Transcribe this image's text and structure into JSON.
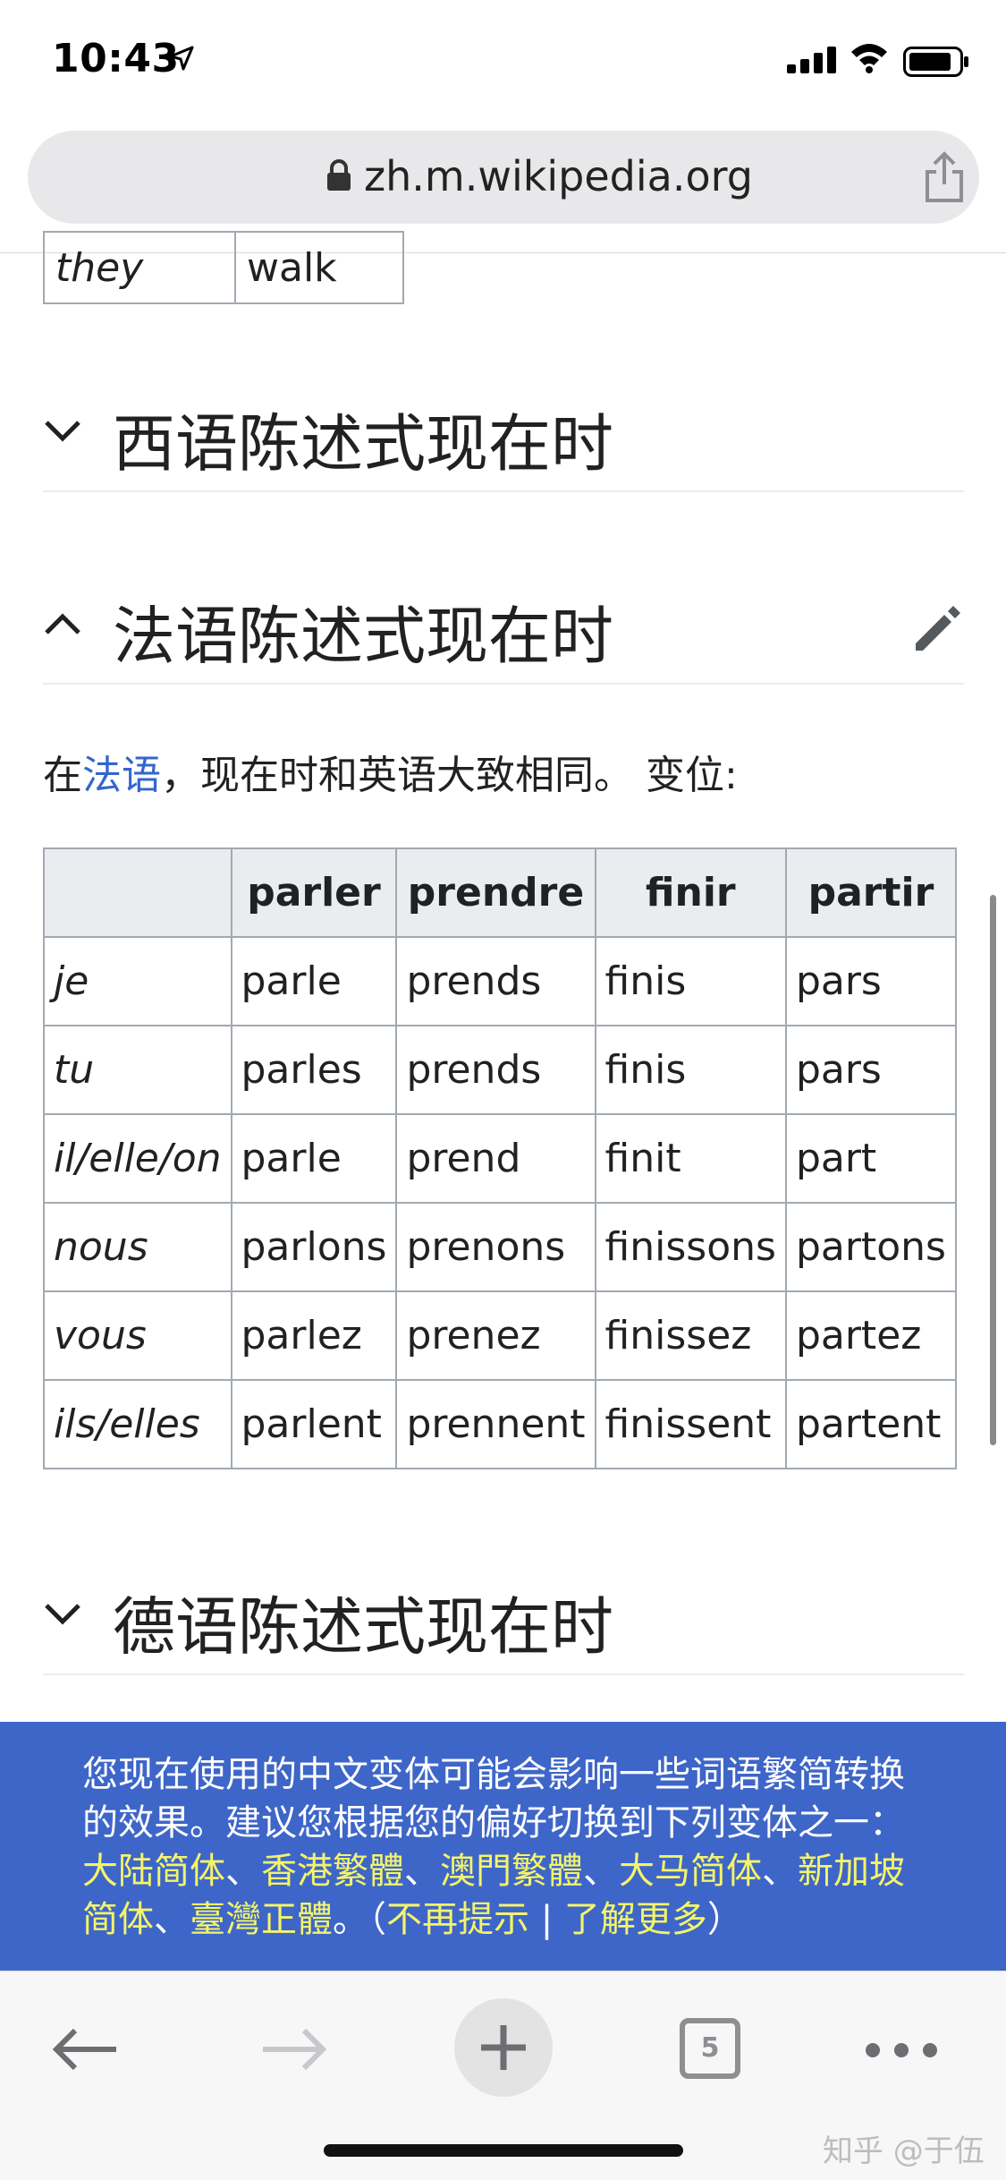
{
  "status_bar": {
    "time": "10:43"
  },
  "browser": {
    "url": "zh.m.wikipedia.org"
  },
  "partial_table": {
    "pronoun": "they",
    "verb": "walk"
  },
  "sections": {
    "spanish": "西语陈述式现在时",
    "french": "法语陈述式现在时",
    "german": "德语陈述式现在时"
  },
  "french_intro": {
    "prefix": "在",
    "link": "法语",
    "suffix": "，现在时和英语大致相同。 变位:"
  },
  "french_table": {
    "headers": [
      "",
      "parler",
      "prendre",
      "finir",
      "partir"
    ],
    "rows": [
      [
        "je",
        "parle",
        "prends",
        "finis",
        "pars"
      ],
      [
        "tu",
        "parles",
        "prends",
        "finis",
        "pars"
      ],
      [
        "il/elle/on",
        "parle",
        "prend",
        "finit",
        "part"
      ],
      [
        "nous",
        "parlons",
        "prenons",
        "finissons",
        "partons"
      ],
      [
        "vous",
        "parlez",
        "prenez",
        "finissez",
        "partez"
      ],
      [
        "ils/elles",
        "parlent",
        "prennent",
        "finissent",
        "partent"
      ]
    ]
  },
  "banner": {
    "text": "您现在使用的中文变体可能会影响一些词语繁简转换的效果。建议您根据您的偏好切换到下列变体之一：",
    "variants": [
      "大陆简体",
      "香港繁體",
      "澳門繁體",
      "大马简体",
      "新加坡简体",
      "臺灣正體"
    ],
    "sep": "、",
    "end": "。",
    "dismiss": "不再提示",
    "learn_more": "了解更多"
  },
  "toolbar": {
    "tab_count": "5"
  },
  "watermark": "知乎 @于伍",
  "colors": {
    "link": "#3366cc",
    "banner_bg": "#3e66c8",
    "banner_highlight": "#f4f46a"
  }
}
